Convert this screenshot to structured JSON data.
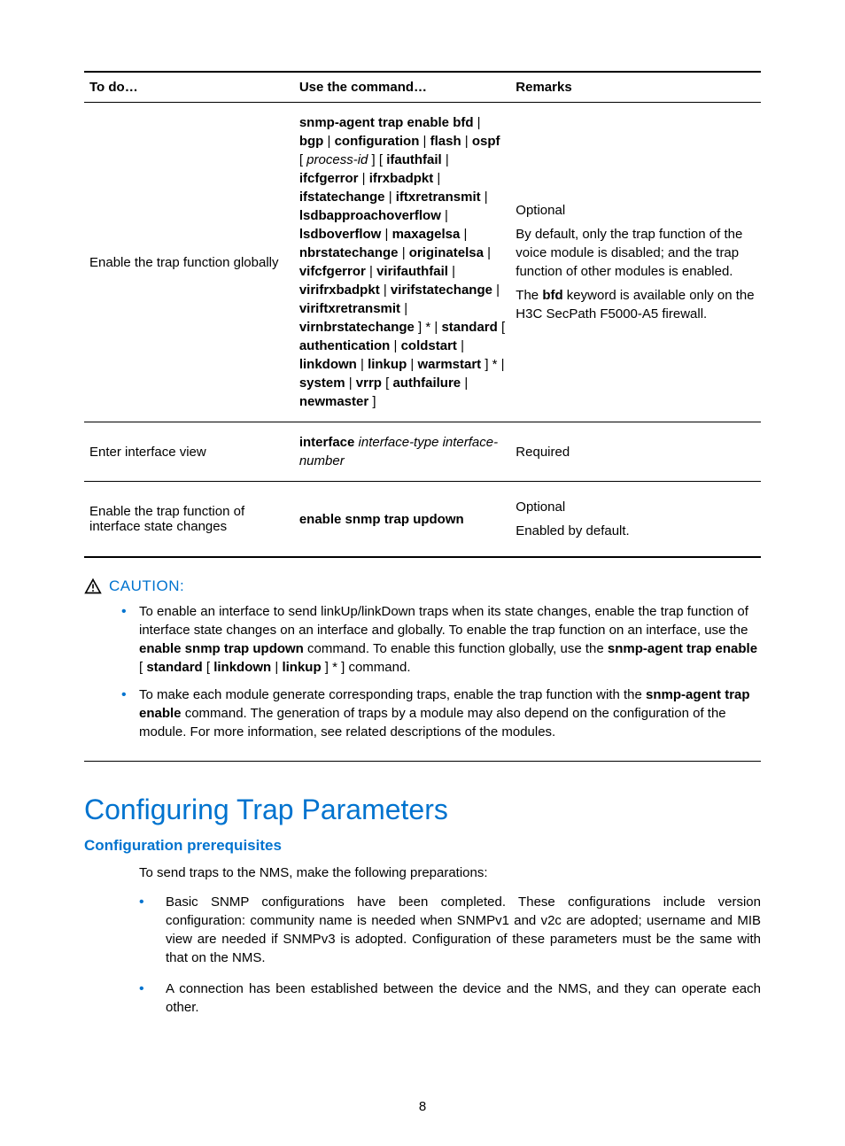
{
  "table": {
    "headers": [
      "To do…",
      "Use the command…",
      "Remarks"
    ],
    "rows": [
      {
        "todo": "Enable the trap function globally",
        "cmd_tokens": [
          {
            "t": "snmp-agent trap enable bfd",
            "s": "bold"
          },
          {
            "t": " | ",
            "s": ""
          },
          {
            "t": "bgp",
            "s": "bold"
          },
          {
            "t": " | ",
            "s": ""
          },
          {
            "t": "configuration",
            "s": "bold"
          },
          {
            "t": " | ",
            "s": ""
          },
          {
            "t": "flash",
            "s": "bold"
          },
          {
            "t": " | ",
            "s": ""
          },
          {
            "t": "ospf",
            "s": "bold"
          },
          {
            "t": " [ ",
            "s": ""
          },
          {
            "t": "process-id",
            "s": "italic"
          },
          {
            "t": " ] [ ",
            "s": ""
          },
          {
            "t": "ifauthfail",
            "s": "bold"
          },
          {
            "t": " | ",
            "s": ""
          },
          {
            "t": "ifcfgerror",
            "s": "bold"
          },
          {
            "t": " | ",
            "s": ""
          },
          {
            "t": "ifrxbadpkt",
            "s": "bold"
          },
          {
            "t": " | ",
            "s": ""
          },
          {
            "t": "ifstatechange",
            "s": "bold"
          },
          {
            "t": " | ",
            "s": ""
          },
          {
            "t": "iftxretransmit",
            "s": "bold"
          },
          {
            "t": " | ",
            "s": ""
          },
          {
            "t": "lsdbapproachoverflow",
            "s": "bold"
          },
          {
            "t": " | ",
            "s": ""
          },
          {
            "t": "lsdboverflow",
            "s": "bold"
          },
          {
            "t": " | ",
            "s": ""
          },
          {
            "t": "maxagelsa",
            "s": "bold"
          },
          {
            "t": " | ",
            "s": ""
          },
          {
            "t": "nbrstatechange",
            "s": "bold"
          },
          {
            "t": " | ",
            "s": ""
          },
          {
            "t": "originatelsa",
            "s": "bold"
          },
          {
            "t": " | ",
            "s": ""
          },
          {
            "t": "vifcfgerror",
            "s": "bold"
          },
          {
            "t": " | ",
            "s": ""
          },
          {
            "t": "virifauthfail",
            "s": "bold"
          },
          {
            "t": " | ",
            "s": ""
          },
          {
            "t": "virifrxbadpkt",
            "s": "bold"
          },
          {
            "t": " | ",
            "s": ""
          },
          {
            "t": "virifstatechange",
            "s": "bold"
          },
          {
            "t": " | ",
            "s": ""
          },
          {
            "t": "viriftxretransmit",
            "s": "bold"
          },
          {
            "t": " | ",
            "s": ""
          },
          {
            "t": "virnbrstatechange",
            "s": "bold"
          },
          {
            "t": " ] * | ",
            "s": ""
          },
          {
            "t": "standard",
            "s": "bold"
          },
          {
            "t": " [ ",
            "s": ""
          },
          {
            "t": "authentication",
            "s": "bold"
          },
          {
            "t": " | ",
            "s": ""
          },
          {
            "t": "coldstart",
            "s": "bold"
          },
          {
            "t": " | ",
            "s": ""
          },
          {
            "t": "linkdown",
            "s": "bold"
          },
          {
            "t": " | ",
            "s": ""
          },
          {
            "t": "linkup",
            "s": "bold"
          },
          {
            "t": " | ",
            "s": ""
          },
          {
            "t": "warmstart",
            "s": "bold"
          },
          {
            "t": " ] * | ",
            "s": ""
          },
          {
            "t": "system",
            "s": "bold"
          },
          {
            "t": " | ",
            "s": ""
          },
          {
            "t": "vrrp",
            "s": "bold"
          },
          {
            "t": " [ ",
            "s": ""
          },
          {
            "t": "authfailure",
            "s": "bold"
          },
          {
            "t": " | ",
            "s": ""
          },
          {
            "t": "newmaster",
            "s": "bold"
          },
          {
            "t": " ]",
            "s": ""
          }
        ],
        "remarks_tokens": [
          {
            "t": "Optional",
            "s": "p"
          },
          {
            "t": "By default, only the trap function of the voice module is disabled; and the trap function of other modules is enabled.",
            "s": "p"
          },
          {
            "t": "The ",
            "s": "p-start"
          },
          {
            "t": "bfd",
            "s": "bold"
          },
          {
            "t": " keyword is available only on the H3C SecPath F5000-A5 firewall.",
            "s": "p-end"
          }
        ]
      },
      {
        "todo": "Enter interface view",
        "cmd_tokens": [
          {
            "t": "interface",
            "s": "bold"
          },
          {
            "t": " ",
            "s": ""
          },
          {
            "t": "interface-type interface-number",
            "s": "italic"
          }
        ],
        "remarks_tokens": [
          {
            "t": "Required",
            "s": "p"
          }
        ]
      },
      {
        "todo": "Enable the trap function of interface state changes",
        "cmd_tokens": [
          {
            "t": "enable snmp trap updown",
            "s": "bold"
          }
        ],
        "remarks_tokens": [
          {
            "t": "Optional",
            "s": "p"
          },
          {
            "t": "Enabled by default.",
            "s": "p"
          }
        ]
      }
    ]
  },
  "caution": {
    "label": "CAUTION:",
    "items": [
      [
        {
          "t": "To enable an interface to send linkUp/linkDown traps when its state changes, enable the trap function of interface state changes on an interface and globally. To enable the trap function on an interface, use the ",
          "s": ""
        },
        {
          "t": "enable snmp trap updown",
          "s": "bold"
        },
        {
          "t": " command. To enable this function globally, use the ",
          "s": ""
        },
        {
          "t": "snmp-agent trap enable",
          "s": "bold"
        },
        {
          "t": " [ ",
          "s": ""
        },
        {
          "t": "standard",
          "s": "bold"
        },
        {
          "t": " [ ",
          "s": ""
        },
        {
          "t": "linkdown",
          "s": "bold"
        },
        {
          "t": " | ",
          "s": ""
        },
        {
          "t": "linkup",
          "s": "bold"
        },
        {
          "t": " ] * ] command.",
          "s": ""
        }
      ],
      [
        {
          "t": "To make each module generate corresponding traps, enable the trap function with the ",
          "s": ""
        },
        {
          "t": "snmp-agent trap enable",
          "s": "bold"
        },
        {
          "t": " command. The generation of traps by a module may also depend on the configuration of the module. For more information, see related descriptions of the modules.",
          "s": ""
        }
      ]
    ]
  },
  "section": {
    "heading": "Configuring Trap Parameters",
    "subheading": "Configuration prerequisites",
    "intro": "To send traps to the NMS, make the following preparations:",
    "bullets": [
      "Basic SNMP configurations have been completed. These configurations include version configuration: community name is needed when SNMPv1 and v2c are adopted; username and MIB view are needed if SNMPv3 is adopted. Configuration of these parameters must be the same with that on the NMS.",
      "A connection has been established between the device and the NMS, and they can operate each other."
    ]
  },
  "page_number": "8"
}
